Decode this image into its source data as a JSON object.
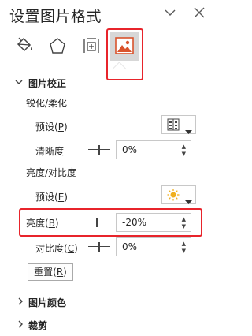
{
  "panel": {
    "title": "设置图片格式",
    "header_icons": {
      "collapse": "chevron-down-icon",
      "close": "close-icon"
    }
  },
  "tabs": [
    {
      "name": "fill-line",
      "icon": "paint-bucket-icon",
      "active": false
    },
    {
      "name": "effects",
      "icon": "pentagon-icon",
      "active": false
    },
    {
      "name": "size-properties",
      "icon": "size-position-icon",
      "active": false
    },
    {
      "name": "picture",
      "icon": "picture-icon",
      "active": true
    }
  ],
  "picture_corrections": {
    "title": "图片校正",
    "sharpen_soften": {
      "heading": "锐化/柔化",
      "presets_label": "预设(",
      "presets_key": "P",
      "sharpness_label": "清晰度",
      "sharpness_value": "0%"
    },
    "brightness_contrast": {
      "heading": "亮度/对比度",
      "presets_label": "预设(",
      "presets_key": "E",
      "brightness_label": "亮度(",
      "brightness_key": "B",
      "brightness_value": "-20%",
      "contrast_label": "对比度(",
      "contrast_key": "C",
      "contrast_value": "0%"
    },
    "reset_label": "重置(",
    "reset_key": "R"
  },
  "picture_color": {
    "title": "图片颜色"
  },
  "crop": {
    "title": "裁剪"
  },
  "colors": {
    "highlight": "#e8242b",
    "active_tab_bg": "#d7d7d7",
    "picture_icon": "#d9532c"
  }
}
